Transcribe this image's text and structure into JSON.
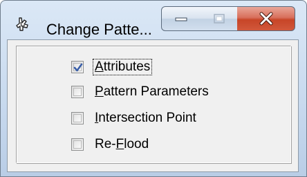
{
  "window": {
    "title": "Change Patte...",
    "caption_buttons": {
      "minimize": "minimize",
      "maximize": "maximize",
      "close": "close"
    }
  },
  "options": [
    {
      "prefix": "",
      "accel": "A",
      "rest": "ttributes",
      "checked": true,
      "focused": true
    },
    {
      "prefix": "",
      "accel": "P",
      "rest": "attern Parameters",
      "checked": false,
      "focused": false
    },
    {
      "prefix": "",
      "accel": "I",
      "rest": "ntersection Point",
      "checked": false,
      "focused": false
    },
    {
      "prefix": "Re-",
      "accel": "F",
      "rest": "lood",
      "checked": false,
      "focused": false
    }
  ],
  "colors": {
    "frame": "#c7d9ee",
    "client": "#f0f0f0",
    "close_button": "#c74527",
    "check_mark": "#3a5fa8"
  }
}
